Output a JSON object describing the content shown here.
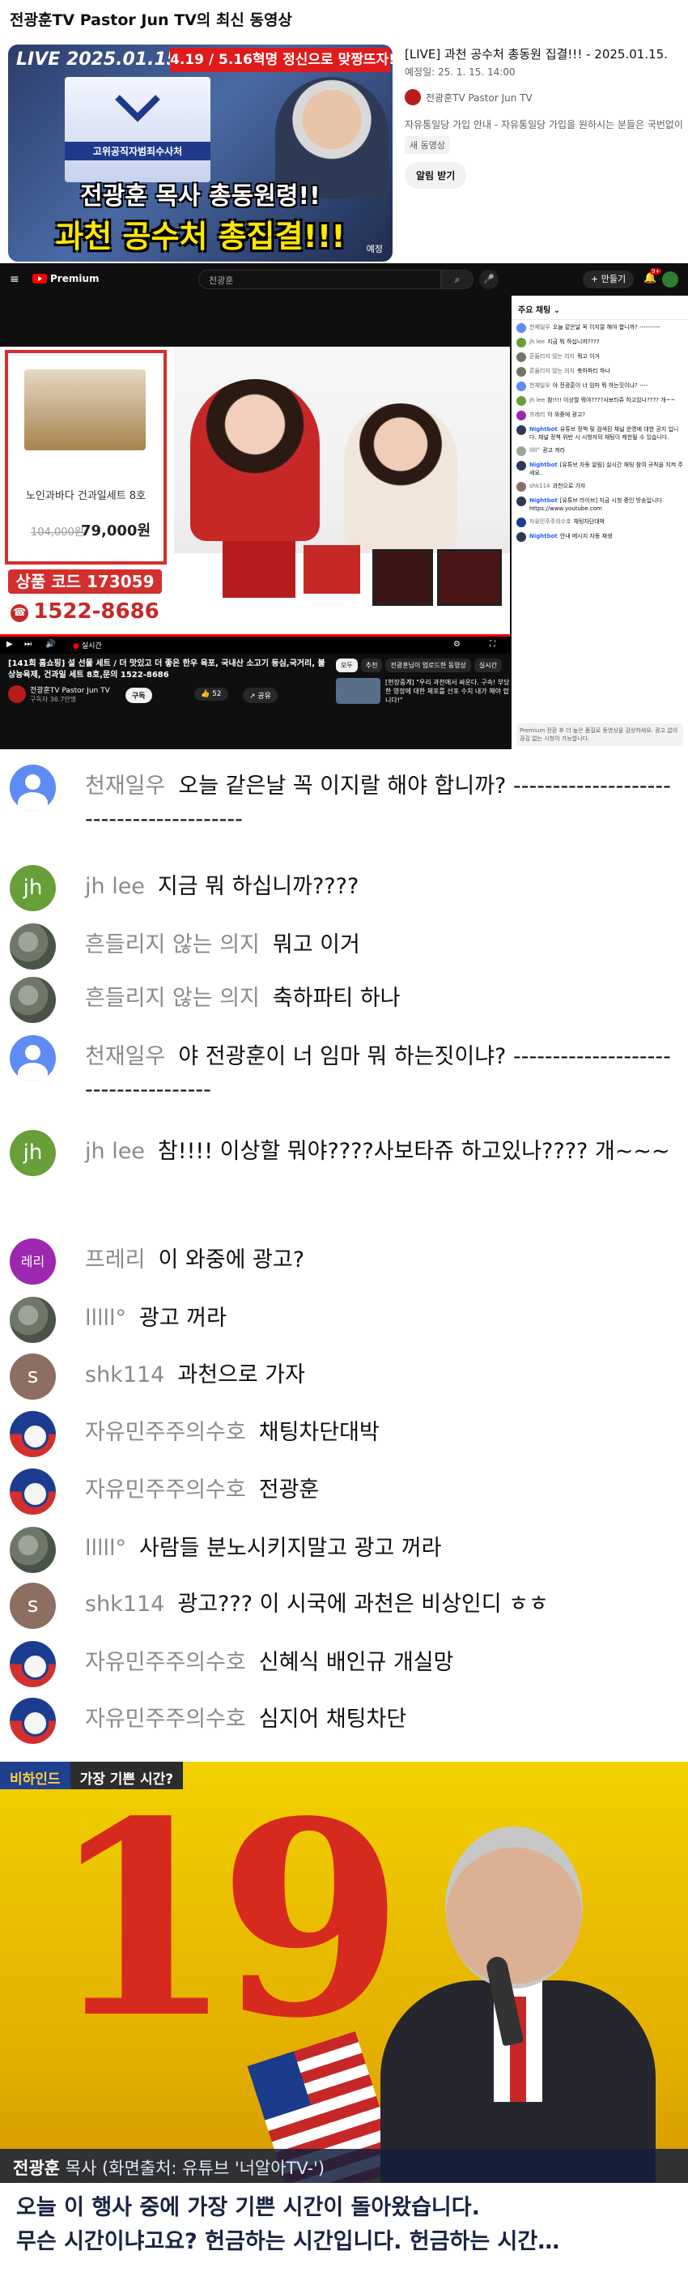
{
  "latest": {
    "heading": "전광훈TV Pastor Jun TV의 최신 동영상",
    "thumb": {
      "live_label": "LIVE",
      "date_label": "2025.01.15",
      "banner": "4.19 / 5.16혁명 정신으로 맞짱뜨자!",
      "podium_text": "고위공직자범죄수사처",
      "caption_line1": "전광훈 목사 총동원령!!",
      "caption_line2": "과천 공수처 총집결!!!",
      "scheduled_tag": "예정"
    },
    "title": "[LIVE] 과천 공수처 총동원 집결!!! - 2025.01.15.",
    "date": "예정일: 25. 1. 15. 14:00",
    "channel": "전광훈TV Pastor Jun TV",
    "description": "자유통일당 가입 안내 - 자유통일당 가입을 원하시는 분들은 국번없이 1",
    "chip": "새 동영상",
    "notify_button": "알림 받기"
  },
  "player_page": {
    "topbar": {
      "menu_icon": "≡",
      "logo_text": "Premium",
      "search_value": "전광훈",
      "search_icon": "⌕",
      "mic_icon": "🎤",
      "create_label": "+ 만들기",
      "bell_icon": "🔔",
      "bell_count": "9+"
    },
    "video": {
      "product_name": "노인과바다 건과일세트 8호",
      "price_old": "104,000원",
      "price_new": "79,000원",
      "product_code": "상품 코드 173059",
      "phone": "1522-8686",
      "phone_icon": "☎",
      "progress_fraction": 1.0,
      "live_label": "실시간",
      "control_icons": {
        "play": "▶",
        "next": "⏭",
        "volume": "🔊",
        "settings": "⚙",
        "fullscreen": "⛶"
      }
    },
    "meta": {
      "title": "[141회 홈쇼핑] 설 선물 세트 / 더 맛있고 더 좋은 한우 육포, 국내산 소고기 등심,국거리, 불상능육제, 건과일 세트 8호,문의 1522-8686",
      "channel": "전광훈TV Pastor Jun TV",
      "subs": "구독자 36.7만명",
      "subscribe": "구독",
      "likes": "👍 52",
      "share": "↗ 공유",
      "chips": [
        "모두",
        "추천",
        "전광훈님이 업로드한 동영상",
        "실시간"
      ],
      "related_title": "[현장중계] \"우리 과천에서 싸운다. 구속! 부당한 영장에 대한 체포를 선포 수치 내가 해야 합니다!\""
    },
    "chat": {
      "header": "주요 채팅 ⌄",
      "messages": [
        {
          "author": "천재일우",
          "text": "오늘 같은날 꼭 이지랄 해야 합니까? ----------",
          "color": "#5e8bf4",
          "bot": false
        },
        {
          "author": "jh lee",
          "text": "지금 뭐 하십니까????",
          "color": "#689f38",
          "bot": false
        },
        {
          "author": "흔들리지 않는 의지",
          "text": "뭐고 이거",
          "color": "#6f7868",
          "bot": false
        },
        {
          "author": "흔들리지 않는 의지",
          "text": "축하파티 하나",
          "color": "#6f7868",
          "bot": false
        },
        {
          "author": "천재일우",
          "text": "야 전광훈이 너 임마 뭐 하는짓이냐? ----",
          "color": "#5e8bf4",
          "bot": false
        },
        {
          "author": "jh lee",
          "text": "참!!!! 이상할 뭐야????사보타쥬 하고있나???? 개~~",
          "color": "#689f38",
          "bot": false
        },
        {
          "author": "프레리",
          "text": "이 와중에 광고?",
          "color": "#9c27b0",
          "bot": false
        },
        {
          "author": "Nightbot",
          "text": "유튜브 정책 및 검색된 채널 운영에 대한 공지 입니다. 채널 정책 위반 시 시청자의 채팅이 제한될 수 있습니다.",
          "color": "#2e3a55",
          "bot": true
        },
        {
          "author": "lllll°",
          "text": "광고 꺼라",
          "color": "#9ea49a",
          "bot": false
        },
        {
          "author": "Nightbot",
          "text": "[유튜브 자동 알림] 실시간 채팅 참여 규칙을 지켜 주세요.",
          "color": "#2e3a55",
          "bot": true
        },
        {
          "author": "shk114",
          "text": "과천으로 가자",
          "color": "#8d6e63",
          "bot": false
        },
        {
          "author": "Nightbot",
          "text": "[유튜브 라이브] 지금 시청 중인 방송입니다. https://www.youtube.com",
          "color": "#2e3a55",
          "bot": true
        },
        {
          "author": "자유민주주의수호",
          "text": "채팅차단대박",
          "color": "#1c3d8f",
          "bot": false
        },
        {
          "author": "Nightbot",
          "text": "안내 메시지 자동 재생",
          "color": "#2e3a55",
          "bot": true
        }
      ],
      "footer": "Premium 전환 후 더 높은 품질로 동영상을 감상하세요. 광고 없이 끊김 없는 시청이 가능합니다."
    }
  },
  "zoom_chat": [
    {
      "author": "천재일우",
      "text": "오늘 같은날 꼭 이지랄 해야 합니까? ----------------------------------------",
      "avatar": "blue",
      "avatar_letter": ""
    },
    {
      "author": "jh lee",
      "text": "지금 뭐 하십니까????",
      "avatar": "green",
      "avatar_letter": "jh"
    },
    {
      "author": "흔들리지 않는 의지",
      "text": "뭐고 이거",
      "avatar": "moss",
      "avatar_letter": ""
    },
    {
      "author": "흔들리지 않는 의지",
      "text": "축하파티 하나",
      "avatar": "moss",
      "avatar_letter": ""
    },
    {
      "author": "천재일우",
      "text": "야 전광훈이 너 임마 뭐 하는짓이냐? ------------------------------------",
      "avatar": "blue",
      "avatar_letter": ""
    },
    {
      "author": "jh lee",
      "text": "참!!!! 이상할 뭐야????사보타쥬 하고있나???? 개~~~",
      "avatar": "green",
      "avatar_letter": "jh"
    },
    {
      "author": "프레리",
      "text": "이 와중에 광고?",
      "avatar": "purple",
      "avatar_letter": "레리"
    },
    {
      "author": "lllll°",
      "text": "광고 꺼라",
      "avatar": "moss",
      "avatar_letter": ""
    },
    {
      "author": "shk114",
      "text": "과천으로 가자",
      "avatar": "brown",
      "avatar_letter": "s"
    },
    {
      "author": "자유민주주의수호",
      "text": "채팅차단대박",
      "avatar": "flag",
      "avatar_letter": ""
    },
    {
      "author": "자유민주주의수호",
      "text": "전광훈",
      "avatar": "flag",
      "avatar_letter": ""
    },
    {
      "author": "lllll°",
      "text": "사람들 분노시키지말고 광고 꺼라",
      "avatar": "moss",
      "avatar_letter": ""
    },
    {
      "author": "shk114",
      "text": "광고??? 이 시국에 과천은 비상인디 ㅎㅎ",
      "avatar": "brown",
      "avatar_letter": "s"
    },
    {
      "author": "자유민주주의수호",
      "text": "신혜식 배인규 개실망",
      "avatar": "flag",
      "avatar_letter": ""
    },
    {
      "author": "자유민주주의수호",
      "text": "심지어 채팅차단",
      "avatar": "flag",
      "avatar_letter": ""
    }
  ],
  "news": {
    "tag_left": "비하인드",
    "tag_right": "가장 기쁜 시간?",
    "big_digits": "19",
    "source_name": "전광훈",
    "source_rest": " 목사 (화면출처: 유튜브 '너알아TV-')",
    "caption_line1": "오늘 이 행사 중에 가장 기쁜 시간이 돌아왔습니다.",
    "caption_line2": "무슨 시간이냐고요? 헌금하는 시간입니다. 헌금하는 시간…"
  }
}
